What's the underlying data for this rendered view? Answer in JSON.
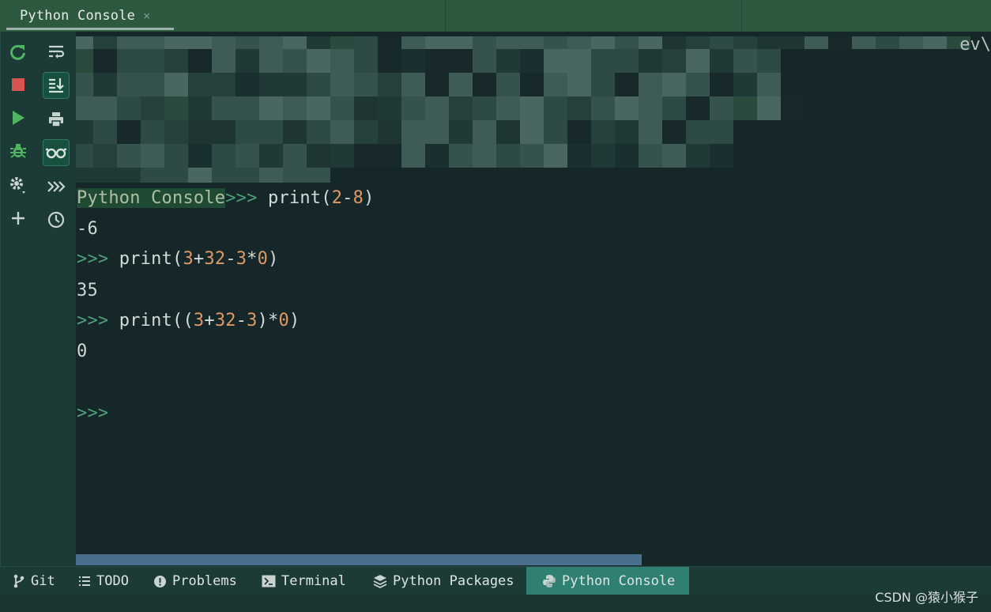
{
  "tab": {
    "title": "Python Console",
    "close": "×"
  },
  "console": {
    "truncated_path_text": "ev\\",
    "prompt_prefix": "Python Console",
    "prompt": ">>>",
    "lines": [
      {
        "cmd": {
          "fn": "print(",
          "a": "2",
          "op1": "-",
          "b": "8",
          "close": ")"
        }
      },
      {
        "output": "-6"
      },
      {
        "cmd": {
          "fn": "print(",
          "a": "3",
          "op1": "+",
          "b": "32",
          "op2": "-",
          "c": "3",
          "op3": "*",
          "d": "0",
          "close": ")"
        }
      },
      {
        "output": "35"
      },
      {
        "cmd": {
          "fn": "print((",
          "a": "3",
          "op1": "+",
          "b": "32",
          "op2": "-",
          "c": "3",
          "op3": ")*",
          "d": "0",
          "close": ")"
        }
      },
      {
        "output": "0"
      }
    ]
  },
  "toolbar_icons": {
    "left": [
      "rerun-icon",
      "stop-icon",
      "run-icon",
      "debug-icon",
      "settings-icon",
      "add-icon"
    ],
    "right": [
      "soft-wrap-icon",
      "scroll-to-end-icon",
      "print-icon",
      "show-variables-icon",
      "execute-more-icon",
      "history-icon"
    ]
  },
  "bottom_tabs": [
    {
      "label": "Git",
      "icon": "git-branch-icon"
    },
    {
      "label": "TODO",
      "icon": "list-icon"
    },
    {
      "label": "Problems",
      "icon": "problems-icon"
    },
    {
      "label": "Terminal",
      "icon": "terminal-icon"
    },
    {
      "label": "Python Packages",
      "icon": "layers-icon"
    },
    {
      "label": "Python Console",
      "icon": "python-icon",
      "active": true
    }
  ],
  "watermark": "CSDN @猿小猴子",
  "colors": {
    "tab_bar": "#2d5a3e",
    "console_bg": "#16272a",
    "prompt": "#4fa07a",
    "number": "#e09964",
    "active_bottom_tab": "#2f7f72",
    "scrollbar": "#4a6f8e"
  }
}
